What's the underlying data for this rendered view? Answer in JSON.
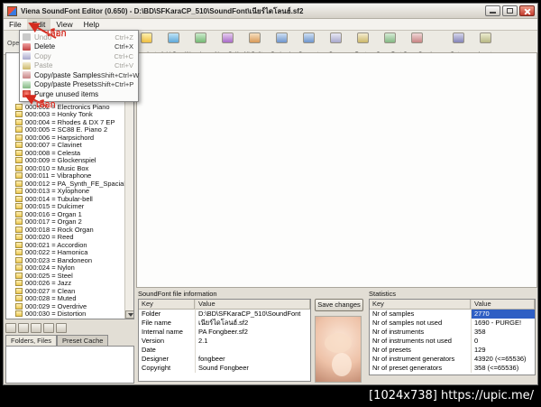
{
  "window": {
    "title": "Viena SoundFont Editor (0.650) - D:\\BD\\SFKaraCP_510\\SoundFont\\เนียร์ไดโลนฮ์.sf2"
  },
  "menubar": {
    "items": [
      {
        "label": "File"
      },
      {
        "label": "Edit",
        "open": true
      },
      {
        "label": "View"
      },
      {
        "label": "Help"
      }
    ]
  },
  "edit_menu": {
    "items": [
      {
        "label": "Undo",
        "shortcut": "Ctrl+Z",
        "disabled": true,
        "icon": "undo-icon"
      },
      {
        "label": "Delete",
        "shortcut": "Ctrl+X",
        "icon": "delete-icon"
      },
      {
        "label": "Copy",
        "shortcut": "Ctrl+C",
        "disabled": true,
        "icon": "copy-icon"
      },
      {
        "label": "Paste",
        "shortcut": "Ctrl+V",
        "disabled": true,
        "icon": "paste-icon"
      },
      {
        "label": "Copy/paste Samples",
        "shortcut": "Shift+Ctrl+W",
        "icon": "copy-samples-icon"
      },
      {
        "label": "Copy/paste Presets",
        "shortcut": "Shift+Ctrl+P",
        "icon": "copy-presets-icon"
      },
      {
        "label": "Purge unused items",
        "shortcut": "",
        "sep": true,
        "icon": "purge-icon"
      }
    ]
  },
  "toolbar": {
    "clipped_label": "Ope",
    "buttons": [
      {
        "label": "New Instr",
        "icon": "new-instr-icon"
      },
      {
        "label": "Add Smpl",
        "icon": "add-smpl-icon"
      },
      {
        "label": "New Layer",
        "icon": "new-layer-icon"
      },
      {
        "label": "New Split",
        "icon": "new-split-icon"
      },
      {
        "label": "All Splits",
        "icon": "all-splits-icon"
      },
      {
        "label": "Go back",
        "icon": "go-back-icon"
      },
      {
        "label": "Go next",
        "icon": "go-next-icon"
      },
      {
        "label": "Copy",
        "icon": "copy-icon"
      },
      {
        "label": "Paste",
        "icon": "paste-icon"
      },
      {
        "label": "Copy Prsts",
        "icon": "copy-presets-icon"
      },
      {
        "label": "Copy Smpls",
        "icon": "copy-samples-icon"
      },
      {
        "label": "Setup",
        "icon": "setup-icon",
        "gap": true
      },
      {
        "label": "Input",
        "icon": "input-icon"
      }
    ]
  },
  "preset_tree": {
    "items": [
      "000:002 = Electronics Piano",
      "000:003 = Honky Tonk",
      "000:004 = Rhodes & DX 7 EP",
      "000:005 = SC88 E. Piano 2",
      "000:006 = Harpsichord",
      "000:007 = Clavinet",
      "000:008 = Celesta",
      "000:009 = Glockenspiel",
      "000:010 = Music Box",
      "000:011 = Vibraphone",
      "000:012 = PA_Synth_FE_Spacial",
      "000:013 = Xylophone",
      "000:014 = Tubular-bell",
      "000:015 = Dulcimer",
      "000:016 = Organ 1",
      "000:017 = Organ 2",
      "000:018 = Rock Organ",
      "000:020 = Reed",
      "000:021 = Accordion",
      "000:022 = Hamonica",
      "000:023 = Bandoneon",
      "000:024 = Nylon",
      "000:025 = Steel",
      "000:026 = Jazz",
      "000:027 = Clean",
      "000:028 = Muted",
      "000:029 = Overdrive",
      "000:030 = Distortion"
    ]
  },
  "left_panel": {
    "mini_icons": [
      "drive-icon",
      "folder-up-icon",
      "refresh-icon",
      "new-folder-icon",
      "list-view-icon"
    ],
    "tabs": [
      {
        "label": "Folders, Files",
        "active": true
      },
      {
        "label": "Preset Cache"
      }
    ]
  },
  "info_panel": {
    "title": "SoundFont file information",
    "columns": [
      "Key",
      "Value"
    ],
    "save_button": "Save changes",
    "rows": [
      {
        "key": "Folder",
        "value": "D:\\BD\\SFKaraCP_510\\SoundFont"
      },
      {
        "key": "File name",
        "value": "เนียร์ไดโลนฮ์.sf2"
      },
      {
        "key": "Internal name",
        "value": "PA Fongbeer.sf2"
      },
      {
        "key": "Version",
        "value": "2.1"
      },
      {
        "key": "Date",
        "value": ""
      },
      {
        "key": "Designer",
        "value": "fongbeer"
      },
      {
        "key": "Copyright",
        "value": "Sound Fongbeer"
      }
    ]
  },
  "stats_panel": {
    "title": "Statistics",
    "columns": [
      "Key",
      "Value"
    ],
    "rows": [
      {
        "key": "Nr of samples",
        "value": "2770",
        "selected": true
      },
      {
        "key": "Nr of samples not used",
        "value": "1690 - PURGE!"
      },
      {
        "key": "Nr of instruments",
        "value": "358"
      },
      {
        "key": "Nr of instruments not used",
        "value": "0"
      },
      {
        "key": "Nr of presets",
        "value": "129"
      },
      {
        "key": "Nr of instrument generators",
        "value": "43920 (<=65536)"
      },
      {
        "key": "Nr of preset generators",
        "value": "358 (<=65536)"
      }
    ]
  },
  "annotations": {
    "select_label_1": "เลือก",
    "select_label_2": "เลือก"
  },
  "footer": {
    "watermark": "[1024x738] https://upic.me/"
  }
}
